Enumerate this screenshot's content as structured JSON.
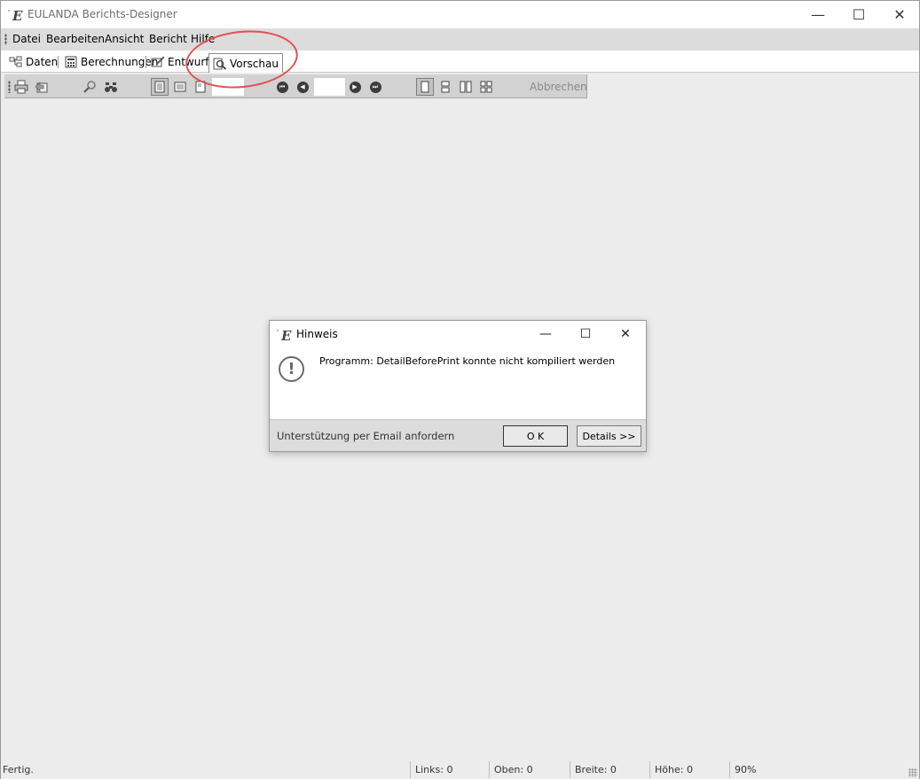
{
  "window": {
    "title": "EULANDA Berichts-Designer",
    "controls": {
      "minimize": "—",
      "maximize": "☐",
      "close": "✕"
    }
  },
  "menu": [
    "Datei",
    "Bearbeiten",
    "Ansicht",
    "Bericht",
    "Hilfe"
  ],
  "tabs": [
    {
      "label": "Daten",
      "icon": "data-tree-icon"
    },
    {
      "label": "Berechnungen",
      "icon": "calculator-icon"
    },
    {
      "label": "Entwurf",
      "icon": "design-pencil-icon"
    },
    {
      "label": "Vorschau",
      "icon": "magnifier-page-icon",
      "active": true
    }
  ],
  "toolbar": {
    "page_input_value": "",
    "zoom_input_value": "",
    "cancel_label": "Abbrechen",
    "nav": {
      "first": "⏮",
      "prev": "◀",
      "next": "▶",
      "last": "⏭"
    }
  },
  "dialog": {
    "title": "Hinweis",
    "message": "Programm: DetailBeforePrint konnte nicht kompiliert werden",
    "support_text": "Unterstützung per Email anfordern",
    "ok_label": "O K",
    "details_label": "Details >>",
    "controls": {
      "minimize": "—",
      "maximize": "☐",
      "close": "✕"
    }
  },
  "statusbar": {
    "status": "Fertig.",
    "links": "Links: 0",
    "oben": "Oben: 0",
    "breite": "Breite: 0",
    "hoehe": "Höhe: 0",
    "zoom": "90%"
  },
  "colors": {
    "annotation": "#e25050",
    "background": "#ececec",
    "menubar": "#dcdcdc",
    "toolbar": "#d2d2d2"
  }
}
